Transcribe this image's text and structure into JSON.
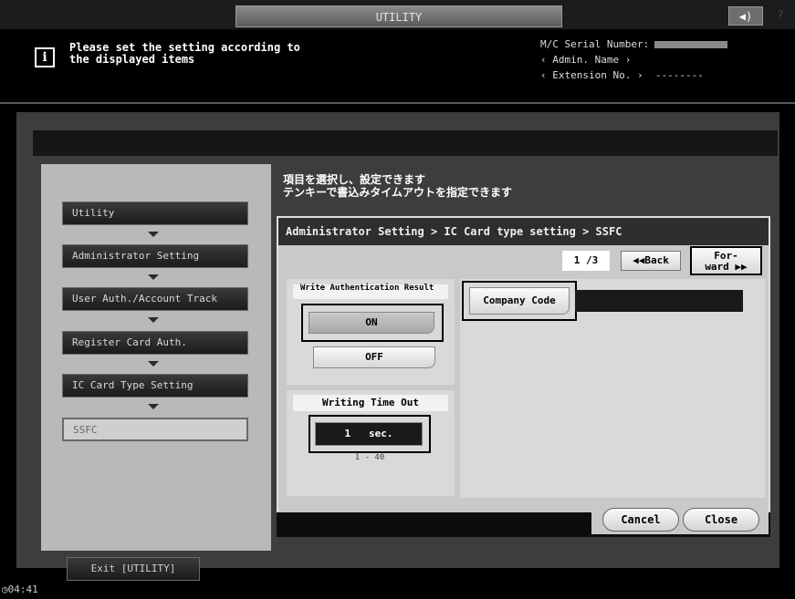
{
  "header": {
    "title": "UTILITY",
    "speaker_icon": "◀)",
    "help_icon": "?"
  },
  "message": {
    "icon": "i",
    "text": "Please set the setting according to\nthe displayed items"
  },
  "machine_info": {
    "serial_label": "M/C Serial Number:",
    "admin_name": "‹ Admin. Name ›",
    "extension": "‹ Extension No. ›",
    "extension_value": "--------"
  },
  "nav": {
    "items": [
      {
        "label": "Utility"
      },
      {
        "label": "Administrator Setting"
      },
      {
        "label": "User Auth./Account Track"
      },
      {
        "label": "Register Card Auth."
      },
      {
        "label": "IC Card Type Setting"
      },
      {
        "label": "SSFC"
      }
    ]
  },
  "instruction": {
    "text": "項目を選択し、設定できます\nテンキーで書込みタイムアウトを指定できます"
  },
  "breadcrumb": "Administrator Setting > IC Card type setting > SSFC",
  "pagination": {
    "indicator": "1 /3",
    "back_label": "◀◀Back",
    "forward_label": "For-\nward ▶▶"
  },
  "write_auth": {
    "label": "Write Authentication Result",
    "on_label": "ON",
    "off_label": "OFF",
    "selected": "ON"
  },
  "timeout": {
    "label": "Writing Time Out",
    "value": "1",
    "unit": "sec.",
    "range": "1 - 40"
  },
  "company_code": {
    "button_label": "Company Code",
    "value": ""
  },
  "footer": {
    "cancel_label": "Cancel",
    "close_label": "Close",
    "exit_label": "Exit [UTILITY]",
    "clock": "04:41"
  }
}
